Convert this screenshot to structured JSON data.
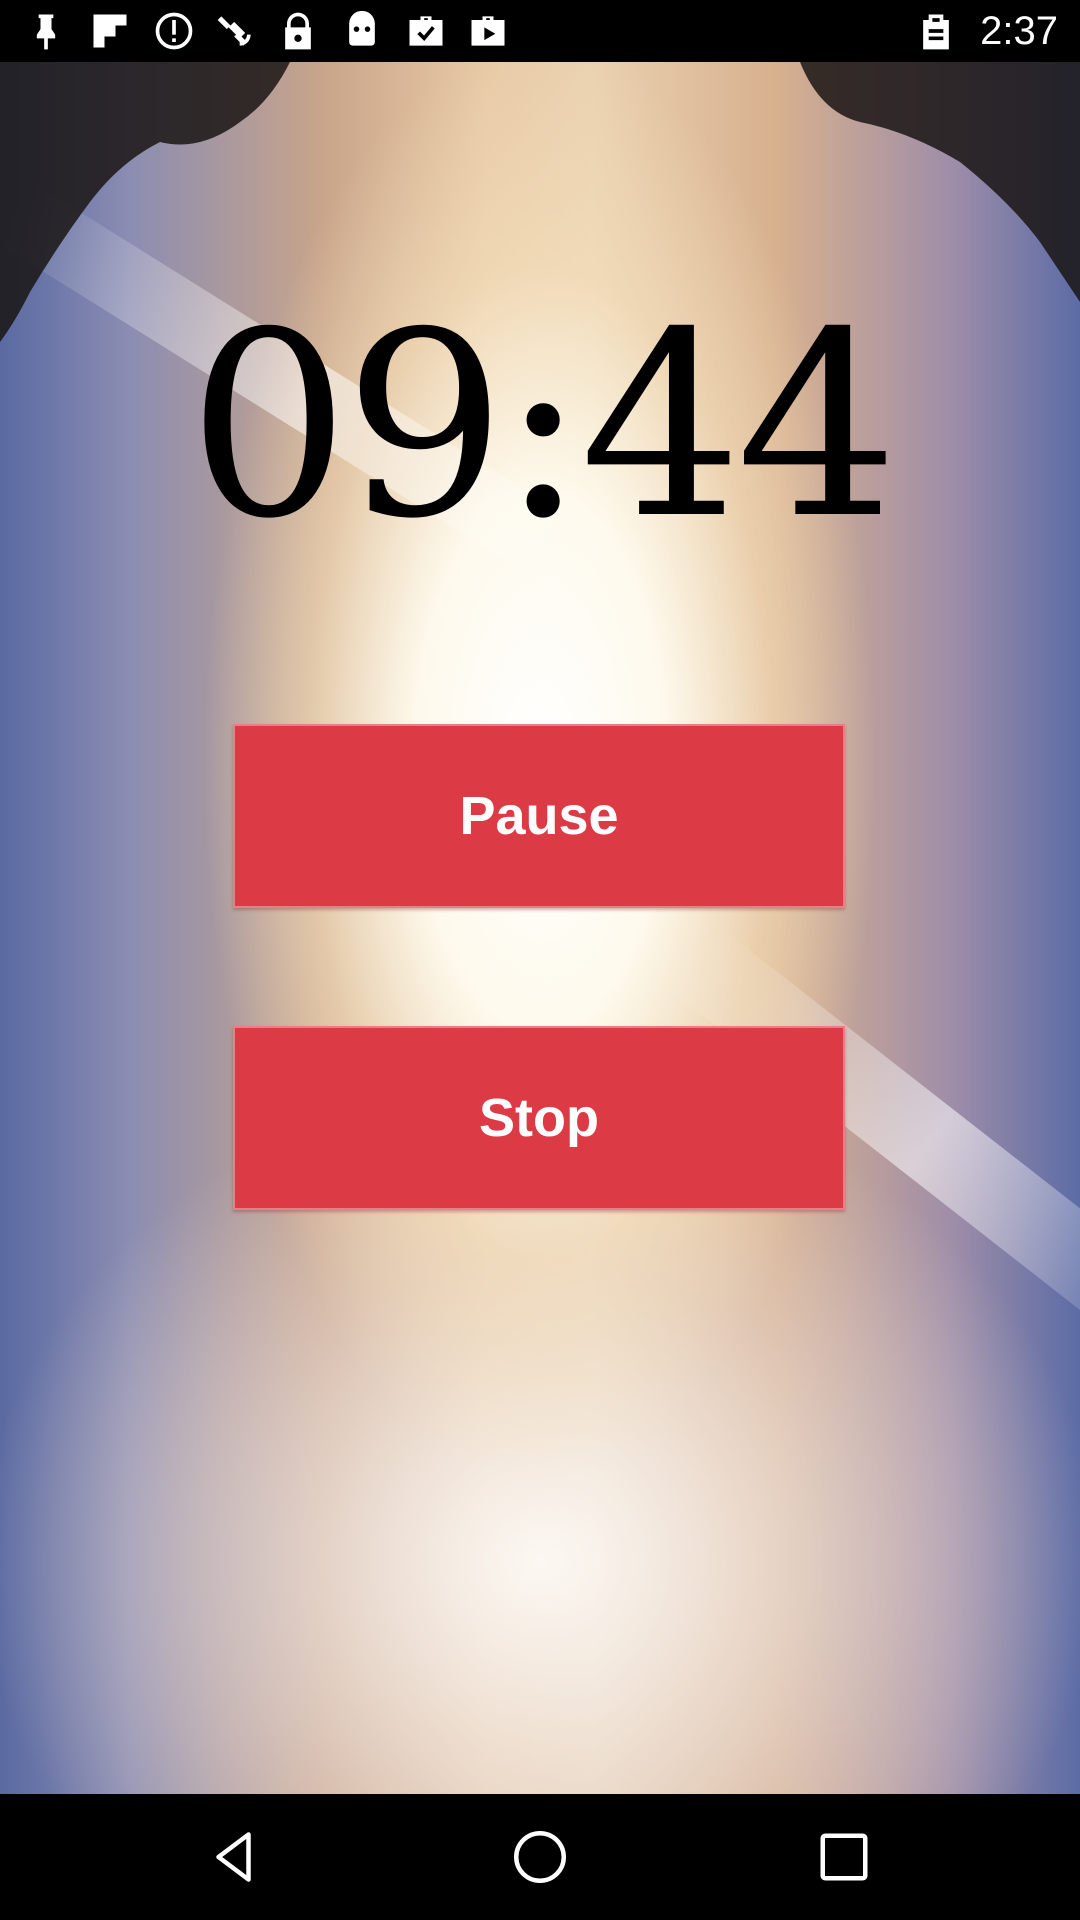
{
  "status_bar": {
    "time": "2:37",
    "left_icons": [
      "pin-icon",
      "flipboard-icon",
      "alert-circle-icon",
      "satellite-icon",
      "lock-icon",
      "android-icon",
      "checked-briefcase-icon",
      "play-briefcase-icon"
    ],
    "right_icons": [
      "clipboard-icon"
    ]
  },
  "timer": {
    "display": "09:44"
  },
  "buttons": {
    "pause_label": "Pause",
    "stop_label": "Stop"
  },
  "colors": {
    "button_red": "#dc3a45",
    "timer_text": "#000000"
  },
  "nav_bar": {
    "icons": [
      "back-icon",
      "home-icon",
      "recent-apps-icon"
    ]
  }
}
